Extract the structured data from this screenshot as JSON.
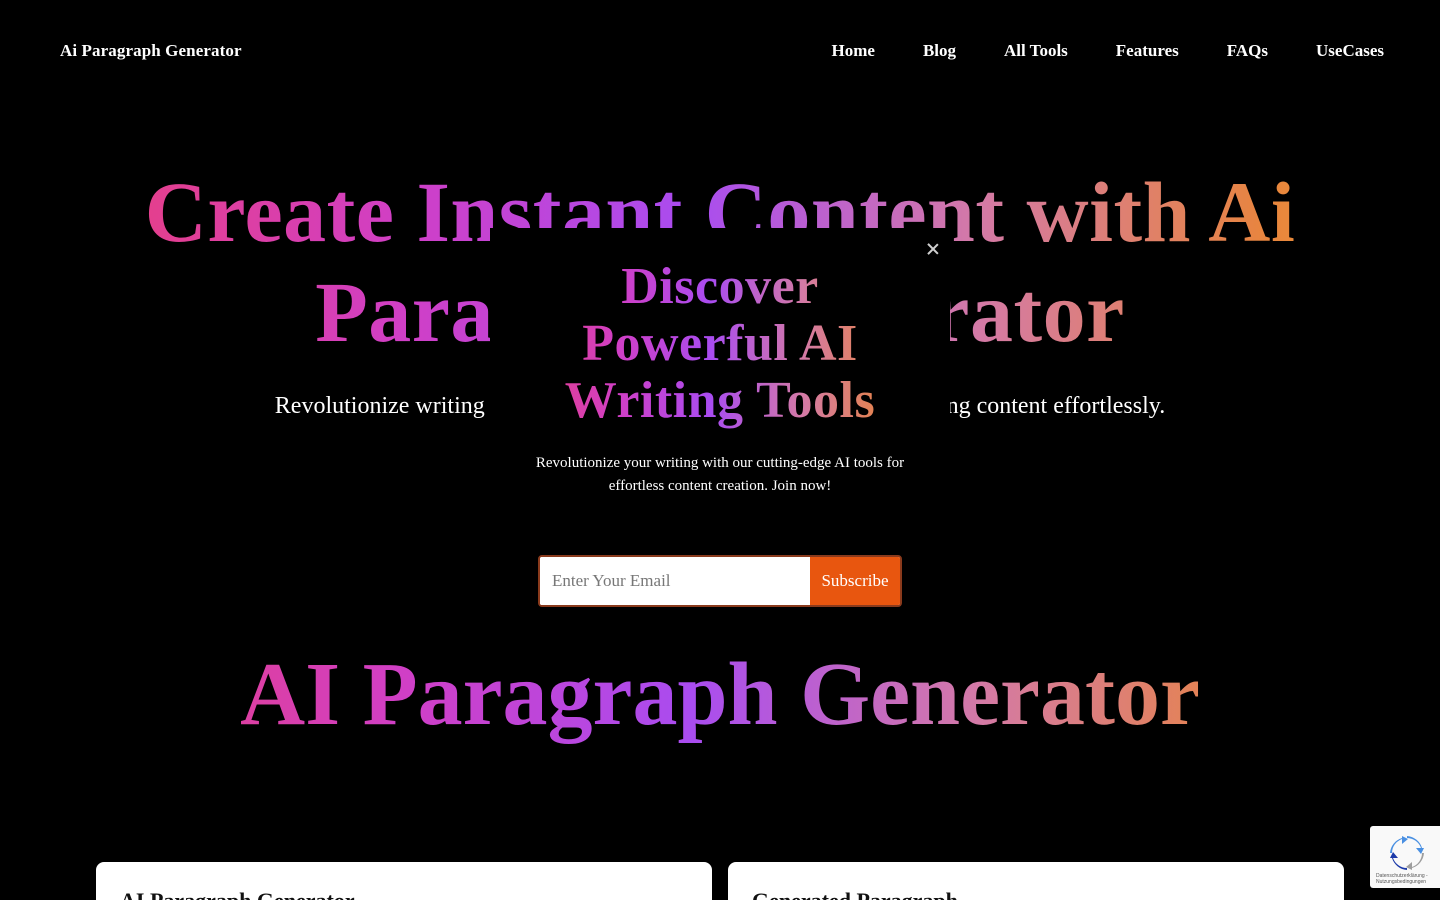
{
  "header": {
    "brand": "Ai Paragraph Generator",
    "nav": [
      "Home",
      "Blog",
      "All Tools",
      "Features",
      "FAQs",
      "UseCases"
    ]
  },
  "hero": {
    "title_line1": "Create Instant Content with Ai",
    "title_line2": "Paragraph Generator",
    "subtitle": "Revolutionize writing with our AI paragraph generator: craft compelling content effortlessly."
  },
  "section": {
    "title": "AI Paragraph Generator"
  },
  "cards": {
    "left_title": "AI Paragraph Generator",
    "right_title": "Generated Paragraph"
  },
  "modal": {
    "title_line1": "Discover",
    "title_line2": "Powerful AI",
    "title_line3": "Writing Tools",
    "text": "Revolutionize your writing with our cutting-edge AI tools for effortless content creation. Join now!",
    "email_placeholder": "Enter Your Email",
    "subscribe_label": "Subscribe"
  },
  "recaptcha": {
    "links": "Datenschutzerklärung - Nutzungsbedingungen"
  },
  "colors": {
    "background": "#000000",
    "subscribe": "#e8560f",
    "gradient_start": "#ef3f6e",
    "gradient_mid": "#a94cf0",
    "gradient_end": "#f0a12a"
  }
}
